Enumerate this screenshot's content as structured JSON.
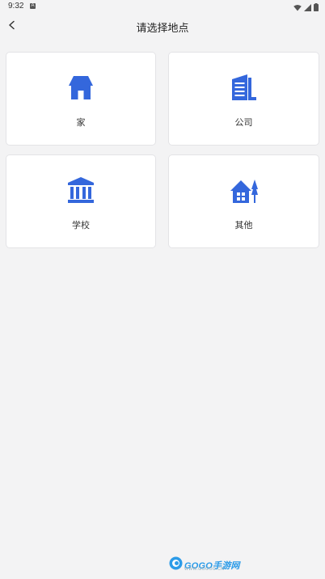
{
  "status_bar": {
    "time": "9:32",
    "notification_icon": "a-badge-icon",
    "right_icons": [
      "wifi-icon",
      "signal-icon",
      "battery-icon"
    ]
  },
  "header": {
    "title": "请选择地点",
    "back_icon": "chevron-left-icon"
  },
  "locations": [
    {
      "label": "家",
      "icon": "house-icon"
    },
    {
      "label": "公司",
      "icon": "office-building-icon"
    },
    {
      "label": "学校",
      "icon": "school-building-icon"
    },
    {
      "label": "其他",
      "icon": "cabin-with-tree-icon"
    }
  ],
  "watermark": {
    "text": "GOGO手游网",
    "sub": "WWW.GOGOO.CN"
  },
  "colors": {
    "icon_blue": "#3467dc",
    "background": "#f3f3f4",
    "card": "#ffffff"
  }
}
